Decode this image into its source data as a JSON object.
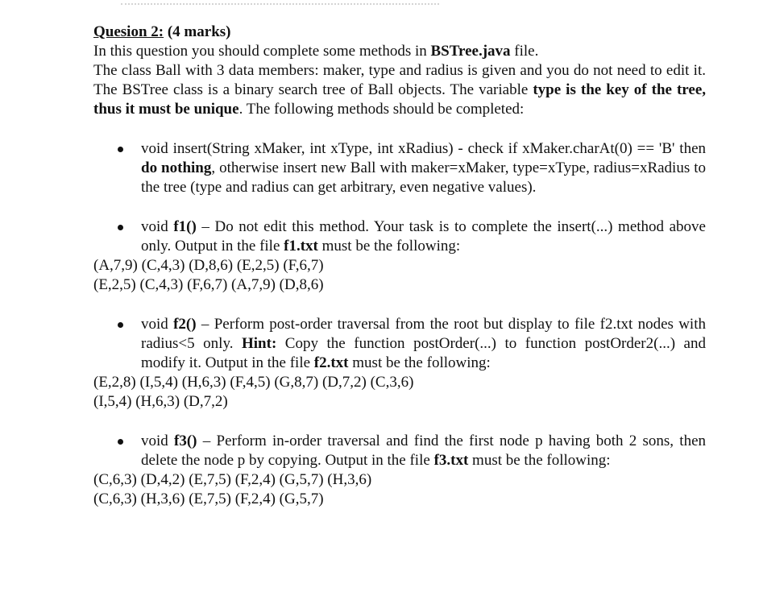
{
  "question": {
    "label": "Quesion 2:",
    "marks": "(4 marks)",
    "intro_line1": "In this question you should complete some methods in ",
    "intro_file": "BSTree.java",
    "intro_line1_end": " file.",
    "para2_a": "The class Ball with 3 data members: maker, type and radius is given and you do not need to edit it. The BSTree class is a binary search tree of  Ball objects. The variable ",
    "para2_bold": "type is the key of the tree, thus it must be unique",
    "para2_b": ". The following methods should be completed:"
  },
  "methods": {
    "insert": {
      "text_a": "void insert(String xMaker, int xType, int xRadius) - check if xMaker.charAt(0) == 'B' then ",
      "bold": "do nothing",
      "text_b": ", otherwise insert new Ball with maker=xMaker, type=xType, radius=xRadius to the tree (type and radius can get arbitrary, even negative values)."
    },
    "f1": {
      "text_a": "void ",
      "name": "f1()",
      "text_b": " – Do not edit this method. Your task is to complete the insert(...) method above only. Output in the file ",
      "file": "f1.txt",
      "text_c": " must be the following:",
      "output": [
        "(A,7,9) (C,4,3) (D,8,6) (E,2,5) (F,6,7)",
        "(E,2,5) (C,4,3) (F,6,7) (A,7,9) (D,8,6)"
      ]
    },
    "f2": {
      "text_a": "void ",
      "name": "f2()",
      "text_b": " – Perform post-order traversal from the root but display to file f2.txt  nodes with radius<5 only. ",
      "hint": "Hint:",
      "text_c": " Copy the function postOrder(...)  to function postOrder2(...) and modify it. Output in the file ",
      "file": "f2.txt",
      "text_d": " must be the following:",
      "output": [
        "(E,2,8) (I,5,4) (H,6,3) (F,4,5) (G,8,7) (D,7,2) (C,3,6)",
        "(I,5,4) (H,6,3) (D,7,2)"
      ]
    },
    "f3": {
      "text_a": "void ",
      "name": "f3()",
      "text_b": " – Perform in-order traversal and find the first node p having both 2 sons, then delete the node p by copying. Output in the file ",
      "file": "f3.txt",
      "text_c": " must be the following:",
      "output": [
        "(C,6,3) (D,4,2) (E,7,5) (F,2,4) (G,5,7) (H,3,6)",
        "(C,6,3) (H,3,6) (E,7,5) (F,2,4) (G,5,7)"
      ]
    }
  }
}
